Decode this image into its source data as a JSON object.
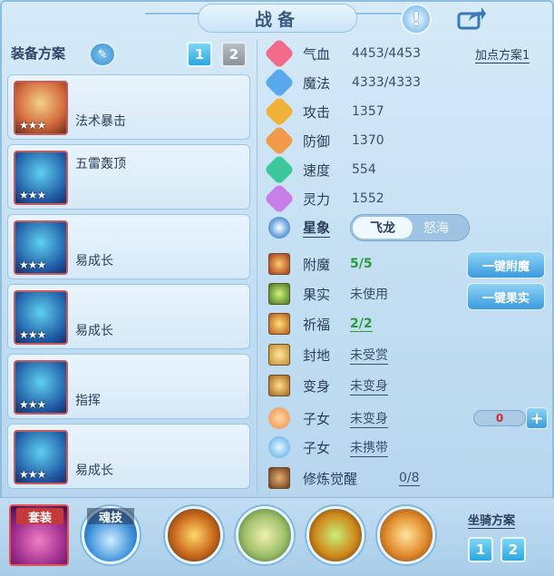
{
  "header": {
    "title": "战备"
  },
  "equipment": {
    "section_label": "装备方案",
    "tabs": [
      "1",
      "2"
    ],
    "stars": "★★★",
    "cards": [
      {
        "name": "法术暴击"
      },
      {
        "name": "五雷轰顶"
      },
      {
        "name": "易成长"
      },
      {
        "name": "易成长"
      },
      {
        "name": "指挥"
      },
      {
        "name": "易成长"
      }
    ]
  },
  "stats": {
    "plan_link": "加点方案1",
    "items": [
      {
        "label": "气血",
        "value": "4453/4453",
        "color": "#f06a8a"
      },
      {
        "label": "魔法",
        "value": "4333/4333",
        "color": "#5aa8ee"
      },
      {
        "label": "攻击",
        "value": "1357",
        "color": "#f2b23a"
      },
      {
        "label": "防御",
        "value": "1370",
        "color": "#f09a4a"
      },
      {
        "label": "速度",
        "value": "554",
        "color": "#3cc89a"
      },
      {
        "label": "灵力",
        "value": "1552",
        "color": "#c77ee6"
      }
    ]
  },
  "constellation": {
    "label": "星象",
    "options": [
      "飞龙",
      "怒海"
    ],
    "selected": "飞龙"
  },
  "attributes": [
    {
      "label": "附魔",
      "value": "5/5",
      "style": "green-plain"
    },
    {
      "label": "果实",
      "value": "未使用",
      "style": "plain"
    },
    {
      "label": "祈福",
      "value": "2/2",
      "style": "green"
    },
    {
      "label": "封地",
      "value": "未受赏",
      "style": "underline"
    },
    {
      "label": "变身",
      "value": "未变身",
      "style": "underline"
    },
    {
      "label": "子女",
      "value": "未变身",
      "style": "underline"
    },
    {
      "label": "子女",
      "value": "未携带",
      "style": "underline"
    },
    {
      "label": "修炼觉醒",
      "value": "0/8",
      "style": "underline"
    }
  ],
  "buttons": {
    "enchant": "一键附魔",
    "fruit": "一键果实"
  },
  "child_counter": {
    "value": "0"
  },
  "bottom": {
    "suit_label": "套装",
    "soul_label": "魂技",
    "mount_label": "坐骑方案",
    "mount_tabs": [
      "1",
      "2"
    ]
  }
}
